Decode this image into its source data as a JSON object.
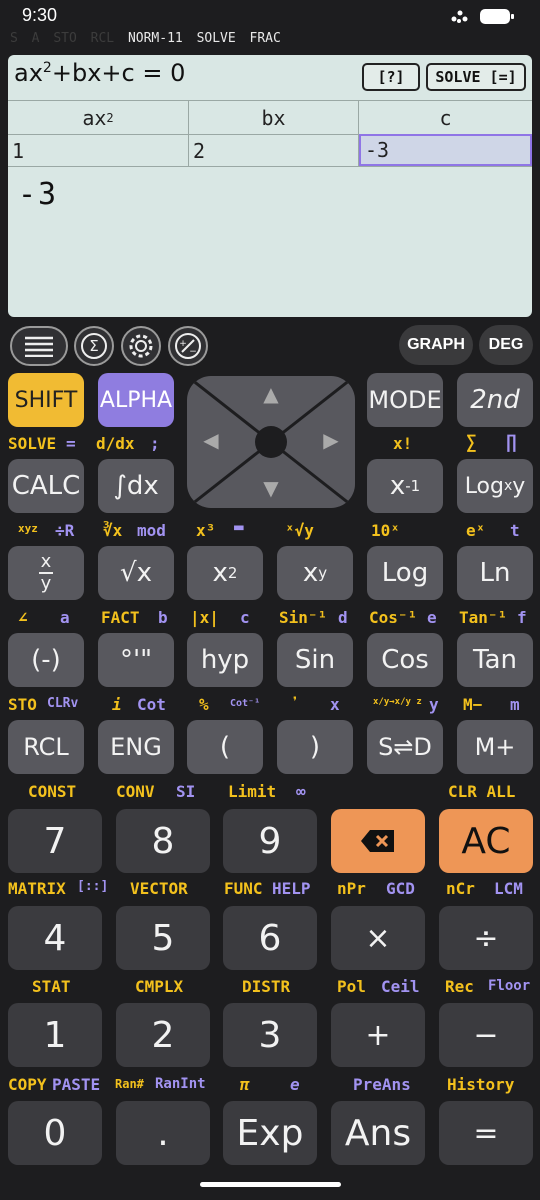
{
  "status": {
    "time": "9:30"
  },
  "indicators": {
    "dim": [
      "S",
      "A",
      "STO",
      "RCL"
    ],
    "on": [
      "NORM-11",
      "SOLVE",
      "FRAC"
    ]
  },
  "display": {
    "equation": {
      "a": "ax",
      "a_sup": "2",
      "rest": "+bx+c  =  0"
    },
    "help_label": "[?]",
    "solve_label": "SOLVE [=]",
    "headers": {
      "a": "ax",
      "a_sup": "2",
      "b": "bx",
      "c": "c"
    },
    "values": {
      "a": "1",
      "b": "2",
      "c": "-3"
    },
    "result": "-3"
  },
  "toolbar": {
    "menu_icon": "menu-icon",
    "sigma_icon": "sigma-icon",
    "settings_icon": "gear-icon",
    "plusminus_icon": "plus-minus-icon",
    "graph_label": "GRAPH",
    "deg_label": "DEG"
  },
  "keys": {
    "shift": "SHIFT",
    "alpha": "ALPHA",
    "mode": "MODE",
    "second": "2nd",
    "calc": "CALC",
    "integral": "∫dx",
    "inverse_base": "x",
    "inverse_sup": "-1",
    "logxy": "Log",
    "logxy_sub": "x",
    "logxy_tail": "y",
    "frac_num": "x",
    "frac_den": "y",
    "sqrt": "√x",
    "sq_base": "x",
    "sq_sup": "2",
    "pow_base": "x",
    "pow_sup": "y",
    "log": "Log",
    "ln": "Ln",
    "neg": "(-)",
    "dms": "°'\"",
    "hyp": "hyp",
    "sin": "Sin",
    "cos": "Cos",
    "tan": "Tan",
    "rcl": "RCL",
    "eng": "ENG",
    "lparen": "(",
    "rparen": ")",
    "sd": "S⇌D",
    "mplus": "M+",
    "n7": "7",
    "n8": "8",
    "n9": "9",
    "ac": "AC",
    "n4": "4",
    "n5": "5",
    "n6": "6",
    "mul": "×",
    "div": "÷",
    "n1": "1",
    "n2": "2",
    "n3": "3",
    "plus": "+",
    "minus": "−",
    "n0": "0",
    "dot": ".",
    "exp": "Exp",
    "ans": "Ans",
    "eq": "="
  },
  "labels": {
    "solve": "SOLVE",
    "eq": "=",
    "ddx": "d/dx",
    "colon": ";",
    "xfact": "x!",
    "sigma": "∑",
    "pi_prod": "∏",
    "xyz": "xyz",
    "divr": "÷R",
    "cbrt": "∛x",
    "mod": "mod",
    "x3": "x³",
    "fracbar": "▬",
    "xrooty": "ˣ√y",
    "tenx": "10ˣ",
    "ex": "eˣ",
    "t": "t",
    "angle": "∠",
    "a": "a",
    "fact": "FACT",
    "b": "b",
    "abs": "|x|",
    "c": "c",
    "asin": "Sin⁻¹",
    "d": "d",
    "acos": "Cos⁻¹",
    "e": "e",
    "atan": "Tan⁻¹",
    "f": "f",
    "sto": "STO",
    "clrv": "CLRv",
    "i": "i",
    "cot": "Cot",
    "percent": "%",
    "cot_inv": "Cot⁻¹",
    "comma": "❜",
    "x": "x",
    "xyconv": "x/y→x/y z",
    "ylbl": "y",
    "mminus": "M−",
    "m": "m",
    "const": "CONST",
    "conv": "CONV",
    "si": "SI",
    "limit": "Limit",
    "inf": "∞",
    "clrall": "CLR ALL",
    "matrix": "MATRIX",
    "matrix_icon": "[::]",
    "vector": "VECTOR",
    "func": "FUNC",
    "help": "HELP",
    "npr": "nPr",
    "gcd": "GCD",
    "ncr": "nCr",
    "lcm": "LCM",
    "stat": "STAT",
    "cmplx": "CMPLX",
    "distr": "DISTR",
    "pol": "Pol",
    "ceil": "Ceil",
    "rec": "Rec",
    "floor": "Floor",
    "copy": "COPY",
    "paste": "PASTE",
    "ran": "Ran#",
    "ranint": "RanInt",
    "pi": "π",
    "e_const": "e",
    "preans": "PreAns",
    "history": "History"
  },
  "colors": {
    "shift": "#f1bb33",
    "alpha": "#8f7de0",
    "ac": "#ee9656"
  }
}
